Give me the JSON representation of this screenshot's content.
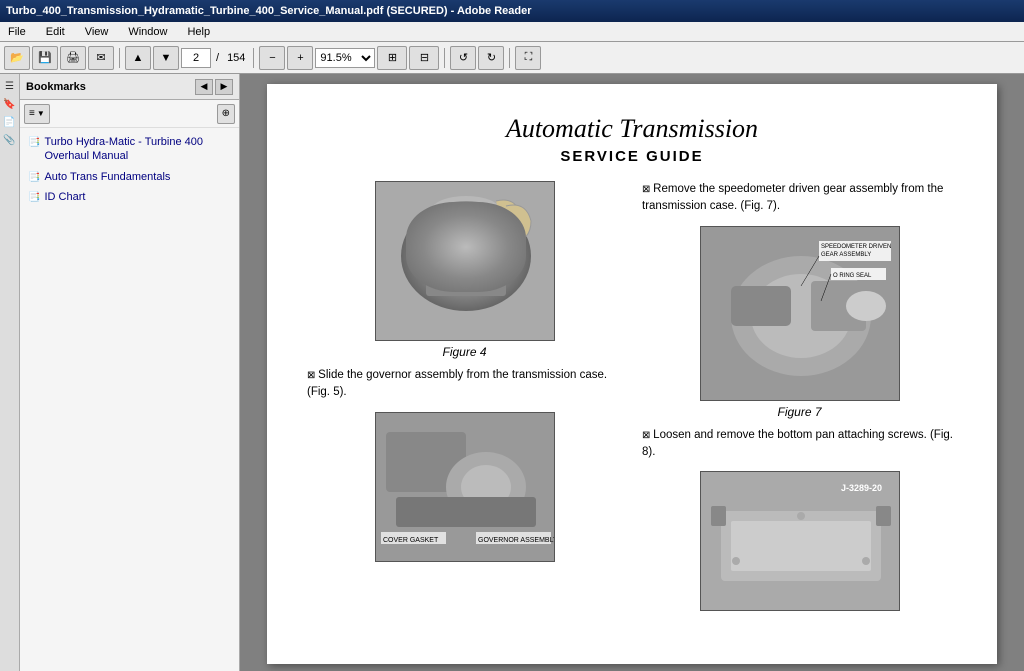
{
  "titlebar": {
    "text": "Turbo_400_Transmission_Hydramatic_Turbine_400_Service_Manual.pdf (SECURED) - Adobe Reader"
  },
  "menubar": {
    "items": [
      "File",
      "Edit",
      "View",
      "Window",
      "Help"
    ]
  },
  "toolbar": {
    "page_current": "2",
    "page_total": "154",
    "zoom": "91.5%"
  },
  "sidebar": {
    "title": "Bookmarks",
    "bookmarks": [
      {
        "label": "Turbo Hydra-Matic - Turbine 400 Overhaul Manual",
        "indent": 0
      },
      {
        "label": "Auto Trans Fundamentals",
        "indent": 0
      },
      {
        "label": "ID Chart",
        "indent": 0
      }
    ]
  },
  "page": {
    "title_script": "Automatic Transmission",
    "subtitle": "SERVICE GUIDE",
    "left_col": {
      "figure4_caption": "Figure 4",
      "text1": "Slide the governor assembly from the transmission case. (Fig. 5).",
      "figure5_label_cover": "COVER GASKET",
      "figure5_label_assembly": "GOVERNOR ASSEMBLY"
    },
    "right_col": {
      "text1": "Remove the speedometer driven gear assembly from the transmission case. (Fig. 7).",
      "figure7_caption": "Figure 7",
      "figure7_label1": "SPEEDOMETER DRIVEN GEAR ASSEMBLY",
      "figure7_label2": "O RING SEAL",
      "text2": "Loosen and remove the bottom pan attaching screws. (Fig. 8).",
      "figure8_label": "J-3289-20"
    }
  }
}
